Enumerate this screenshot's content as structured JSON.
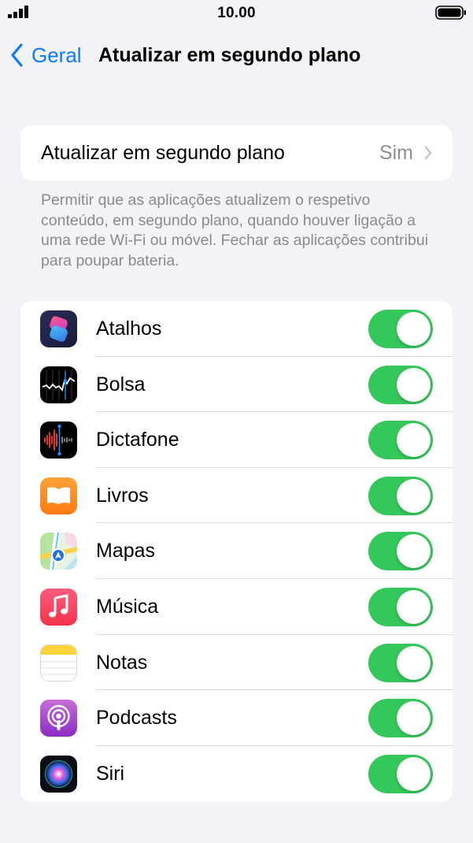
{
  "status_bar": {
    "time": "10.00"
  },
  "nav": {
    "back_label": "Geral",
    "title": "Atualizar em segundo plano"
  },
  "main_setting": {
    "label": "Atualizar em segundo plano",
    "value": "Sim"
  },
  "footer_note": "Permitir que as aplicações atualizem o respetivo conteúdo, em segundo plano, quando houver ligação a uma rede Wi-Fi ou móvel. Fechar as aplicações contribui para poupar bateria.",
  "apps": [
    {
      "label": "Atalhos",
      "icon": "shortcuts-icon",
      "enabled": true
    },
    {
      "label": "Bolsa",
      "icon": "stocks-icon",
      "enabled": true
    },
    {
      "label": "Dictafone",
      "icon": "voice-memos-icon",
      "enabled": true
    },
    {
      "label": "Livros",
      "icon": "books-icon",
      "enabled": true
    },
    {
      "label": "Mapas",
      "icon": "maps-icon",
      "enabled": true
    },
    {
      "label": "Música",
      "icon": "music-icon",
      "enabled": true
    },
    {
      "label": "Notas",
      "icon": "notes-icon",
      "enabled": true
    },
    {
      "label": "Podcasts",
      "icon": "podcasts-icon",
      "enabled": true
    },
    {
      "label": "Siri",
      "icon": "siri-icon",
      "enabled": true
    }
  ],
  "colors": {
    "accent": "#0a7aff",
    "toggle_on": "#34c759",
    "background": "#f2f2f7"
  }
}
